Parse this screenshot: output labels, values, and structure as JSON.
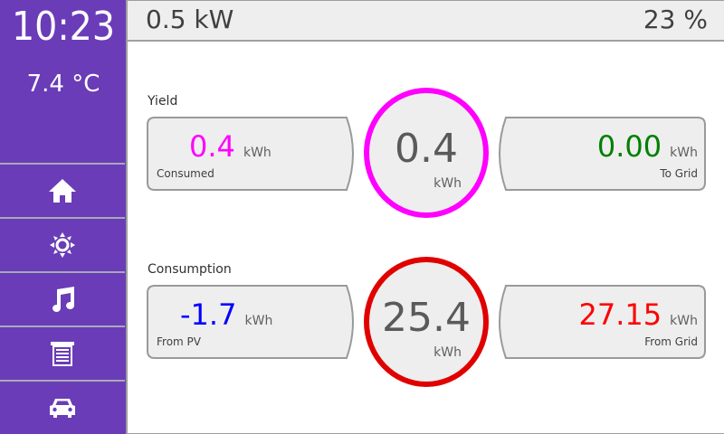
{
  "sidebar": {
    "time": "10:23",
    "temperature": "7.4 °C",
    "nav": [
      {
        "icon": "home-icon"
      },
      {
        "icon": "sun-icon"
      },
      {
        "icon": "music-note-icon"
      },
      {
        "icon": "garage-door-icon"
      },
      {
        "icon": "car-icon"
      }
    ]
  },
  "topbar": {
    "power": "0.5 kW",
    "percent": "23 %"
  },
  "yield": {
    "label": "Yield",
    "left": {
      "value": "0.4",
      "unit": "kWh",
      "caption": "Consumed",
      "color": "#ff00ff"
    },
    "center": {
      "value": "0.4",
      "unit": "kWh",
      "ring_color": "#ff00ff"
    },
    "right": {
      "value": "0.00",
      "unit": "kWh",
      "caption": "To Grid",
      "color": "#008000"
    }
  },
  "consumption": {
    "label": "Consumption",
    "left": {
      "value": "-1.7",
      "unit": "kWh",
      "caption": "From PV",
      "color": "#0000ff"
    },
    "center": {
      "value": "25.4",
      "unit": "kWh",
      "ring_color": "#e00000"
    },
    "right": {
      "value": "27.15",
      "unit": "kWh",
      "caption": "From Grid",
      "color": "#ff0000"
    }
  }
}
